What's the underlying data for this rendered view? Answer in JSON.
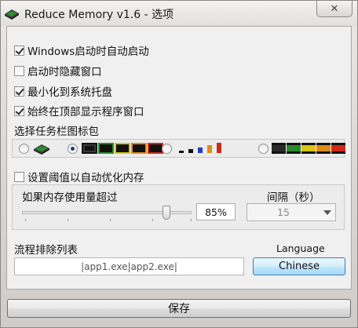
{
  "window": {
    "title": "Reduce Memory v1.6 - 选项",
    "close_glyph": "✕"
  },
  "options": {
    "autostart": {
      "label": "Windows启动时自动启动",
      "checked": true
    },
    "hide_on_start": {
      "label": "启动时隐藏窗口",
      "checked": false
    },
    "minimize_to_tray": {
      "label": "最小化到系统托盘",
      "checked": true
    },
    "always_on_top": {
      "label": "始终在顶部显示程序窗口",
      "checked": true
    }
  },
  "icon_pack": {
    "section_label": "选择任务栏图标包",
    "selected_index": 1,
    "packs": [
      "memory-chip-pack-icon",
      "black-chip-bars-pack-icon",
      "small-bars-pack-icon",
      "colored-chip-bars-pack-icon"
    ]
  },
  "threshold": {
    "checkbox_label": "设置阈值以自动优化内存",
    "checked": false,
    "usage_label": "如果内存使用量超过",
    "slider_level_percent": 85,
    "percent_text": "85%",
    "interval_label": "间隔（秒）",
    "interval_value": "15"
  },
  "exclusions": {
    "label": "流程排除列表",
    "value": "|app1.exe|app2.exe|"
  },
  "language": {
    "label": "Language",
    "button_label": "Chinese"
  },
  "footer": {
    "save_label": "保存"
  },
  "colors": {
    "accent_button_border": "#3c7fb1",
    "radio_dot": "#1b3d7a"
  }
}
